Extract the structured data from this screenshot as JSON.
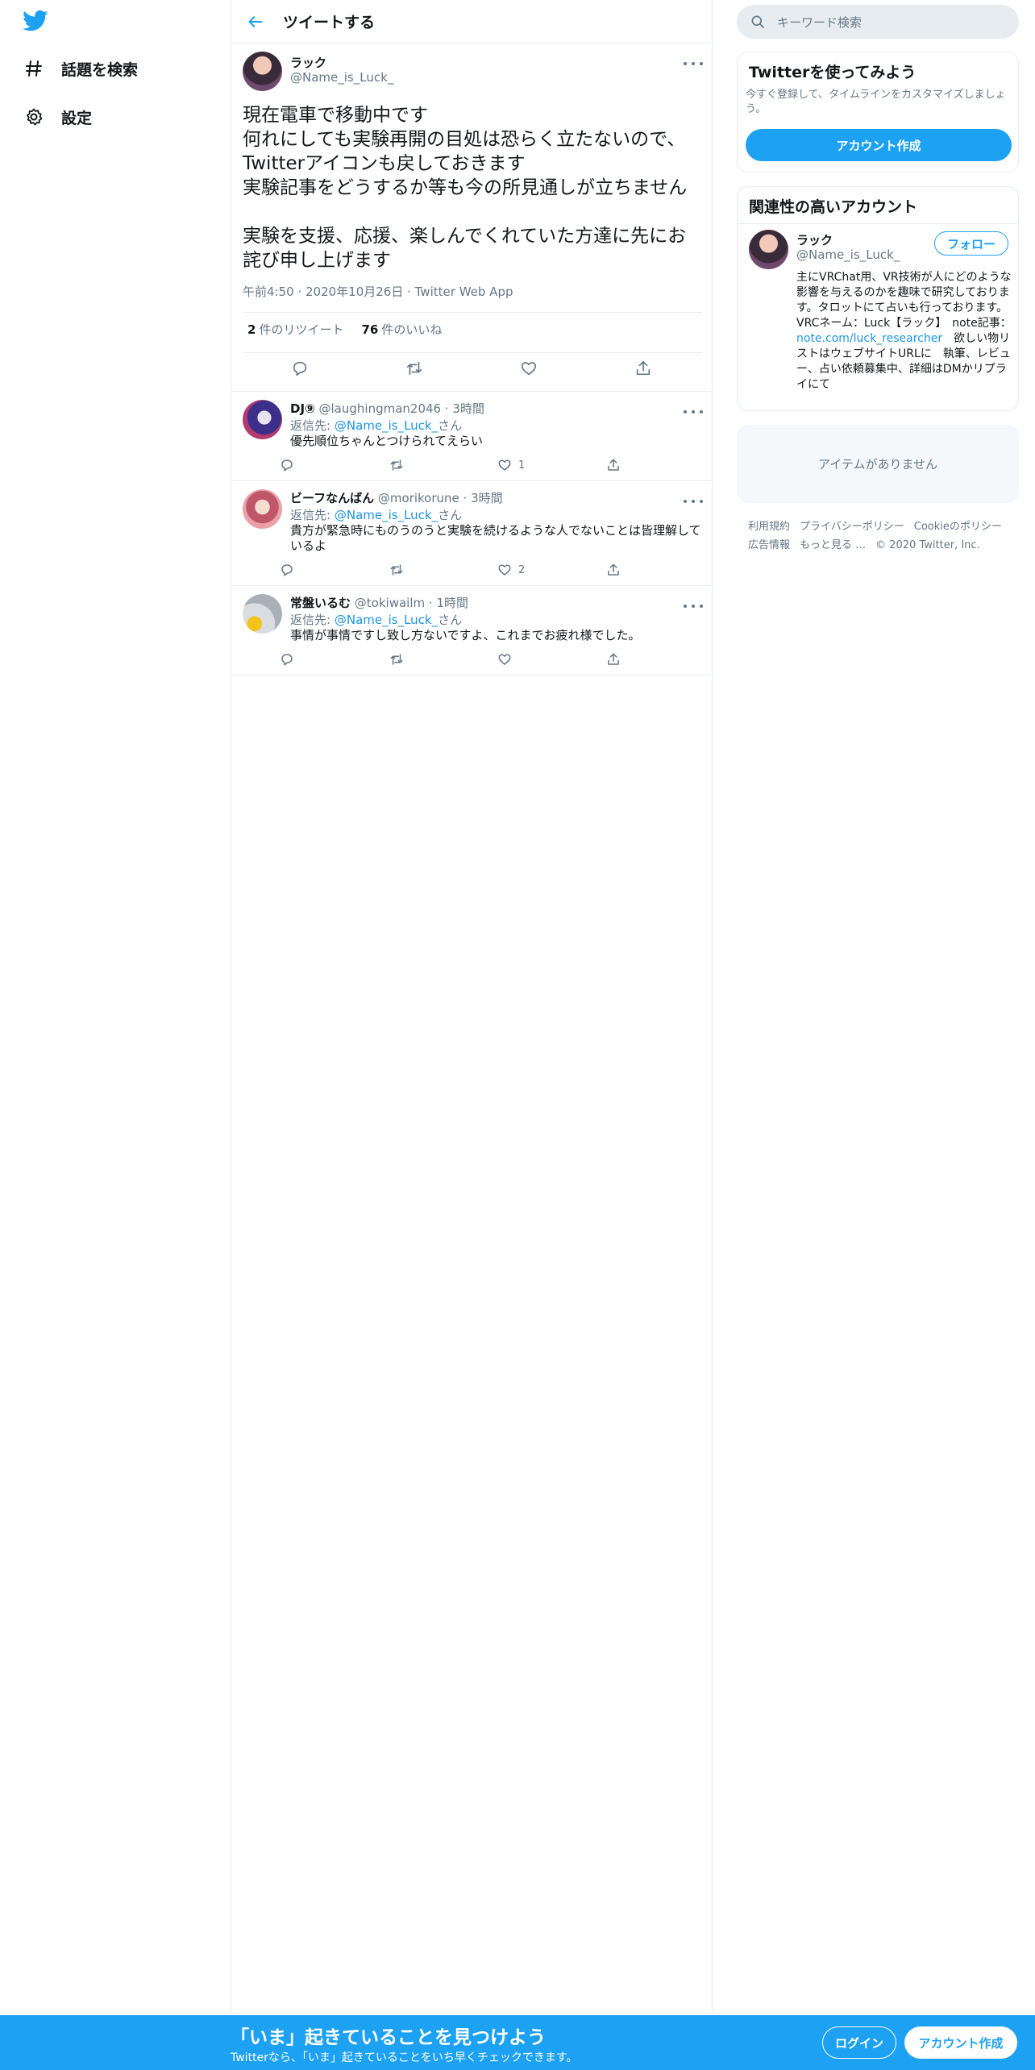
{
  "nav": {
    "explore_label": "話題を検索",
    "settings_label": "設定"
  },
  "header": {
    "title": "ツイートする"
  },
  "tweet": {
    "name": "ラック",
    "handle": "@Name_is_Luck_",
    "text": "現在電車で移動中です\n何れにしても実験再開の目処は恐らく立たないので、Twitterアイコンも戻しておきます\n実験記事をどうするか等も今の所見通しが立ちません\n\n実験を支援、応援、楽しんでくれていた方達に先にお詫び申し上げます",
    "time": "午前4:50",
    "date": "2020年10月26日",
    "source": "Twitter Web App",
    "retweets_count": "2",
    "retweets_label": "件のリツイート",
    "likes_count": "76",
    "likes_label": "件のいいね"
  },
  "replies": [
    {
      "name": "DJ⑨",
      "handle": "@laughingman2046",
      "time": "3時間",
      "reply_prefix": "返信先:",
      "reply_to": "@Name_is_Luck_",
      "reply_suffix": "さん",
      "text": "優先順位ちゃんとつけられてえらい",
      "likes": "1"
    },
    {
      "name": "ビーフなんばん",
      "handle": "@morikorune",
      "time": "3時間",
      "reply_prefix": "返信先:",
      "reply_to": "@Name_is_Luck_",
      "reply_suffix": "さん",
      "text": "貴方が緊急時にものうのうと実験を続けるような人でないことは皆理解しているよ",
      "likes": "2"
    },
    {
      "name": "常盤いるむ",
      "handle": "@tokiwailm",
      "time": "1時間",
      "reply_prefix": "返信先:",
      "reply_to": "@Name_is_Luck_",
      "reply_suffix": "さん",
      "text": "事情が事情ですし致し方ないですよ、これまでお疲れ様でした。",
      "likes": ""
    }
  ],
  "sidebar": {
    "search_placeholder": "キーワード検索",
    "signup_card": {
      "title": "Twitterを使ってみよう",
      "subtitle": "今すぐ登録して、タイムラインをカスタマイズしましょう。",
      "button": "アカウント作成"
    },
    "related": {
      "title": "関連性の高いアカウント",
      "name": "ラック",
      "handle": "@Name_is_Luck_",
      "follow": "フォロー",
      "bio_part1": "主にVRChat用、VR技術が人にどのような影響を与えるのかを趣味で研究しております。タロットにて占いも行っております。VRCネーム：Luck【ラック】　note記事：",
      "bio_link": "note.com/luck_researcher",
      "bio_part2": "　欲しい物リストはウェブサイトURLに　執筆、レビュー、占い依頼募集中、詳細はDMかリプライにて"
    },
    "empty_text": "アイテムがありません",
    "footer_links": [
      "利用規約",
      "プライバシーポリシー",
      "Cookieのポリシー",
      "広告情報",
      "もっと見る …"
    ],
    "copyright": "© 2020 Twitter, Inc."
  },
  "bottom_bar": {
    "title": "「いま」起きていることを見つけよう",
    "subtitle": "Twitterなら、「いま」起きていることをいち早くチェックできます。",
    "login": "ログイン",
    "signup": "アカウント作成"
  },
  "colors": {
    "accent": "#1da1f2",
    "text": "#14171a",
    "muted": "#657786",
    "border": "#e6ecf0"
  }
}
